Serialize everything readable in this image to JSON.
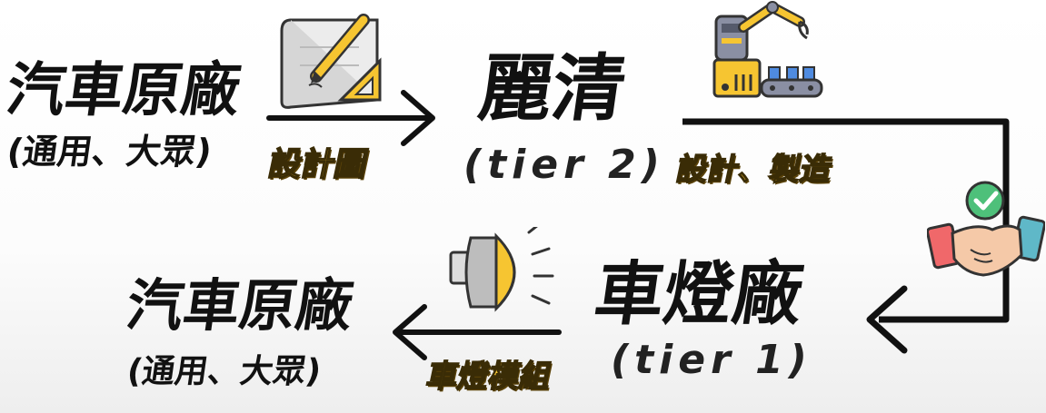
{
  "nodes": {
    "oem_top": {
      "title": "汽車原廠",
      "subtitle": "(通用、大眾)"
    },
    "tier2": {
      "title": "麗清",
      "subtitle": "(tier 2)"
    },
    "tier1": {
      "title": "車燈廠",
      "subtitle": "(tier 1)"
    },
    "oem_bottom": {
      "title": "汽車原廠",
      "subtitle": "(通用、大眾)"
    }
  },
  "edges": {
    "oem_to_tier2": "設計圖",
    "tier2_to_tier1": "設計、製造",
    "tier1_to_oem": "車燈模組"
  },
  "icons": [
    "blueprint-icon",
    "robot-arm-factory-icon",
    "handshake-check-icon",
    "headlight-icon"
  ],
  "colors": {
    "accent": "#f6c531",
    "text": "#111111"
  }
}
